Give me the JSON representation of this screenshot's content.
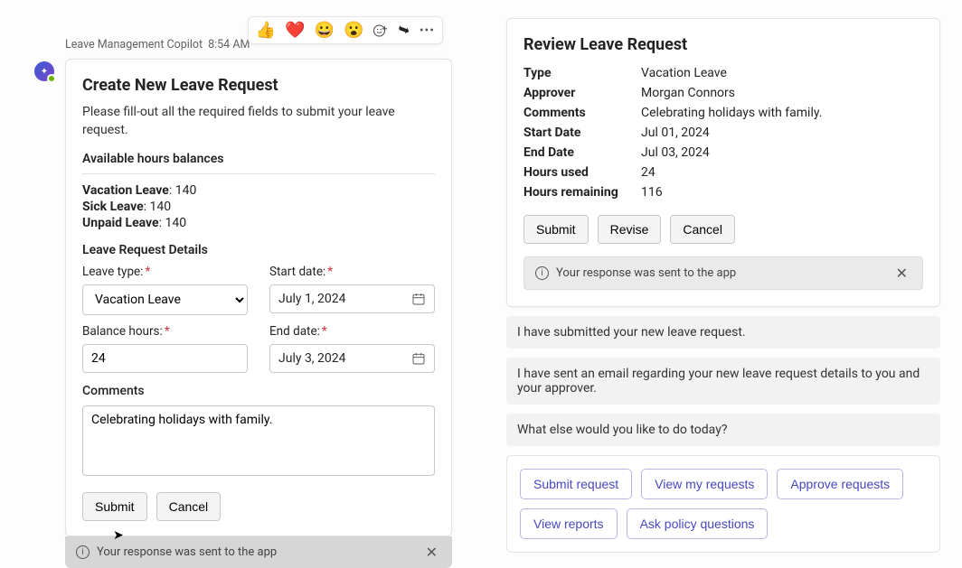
{
  "sender": {
    "name": "Leave Management Copilot",
    "time": "8:54 AM"
  },
  "card1": {
    "title": "Create New Leave Request",
    "intro": "Please fill-out all the required fields to submit your leave request.",
    "balances_heading": "Available hours balances",
    "balances": {
      "vacation_label": "Vacation Leave",
      "vacation_val": "140",
      "sick_label": "Sick Leave",
      "sick_val": "140",
      "unpaid_label": "Unpaid Leave",
      "unpaid_val": "140"
    },
    "details_heading": "Leave Request Details",
    "fields": {
      "leave_type_label": "Leave type:",
      "leave_type_value": "Vacation Leave",
      "start_date_label": "Start date:",
      "start_date_value": "July 1, 2024",
      "balance_hours_label": "Balance hours:",
      "balance_hours_value": "24",
      "end_date_label": "End date:",
      "end_date_value": "July 3, 2024",
      "comments_label": "Comments",
      "comments_value": "Celebrating holidays with family."
    },
    "buttons": {
      "submit": "Submit",
      "cancel": "Cancel"
    },
    "response_sent": "Your response was sent to the app"
  },
  "card2": {
    "title": "Review Leave Request",
    "rows": {
      "type_k": "Type",
      "type_v": "Vacation Leave",
      "approver_k": "Approver",
      "approver_v": "Morgan Connors",
      "comments_k": "Comments",
      "comments_v": "Celebrating holidays with family.",
      "start_k": "Start Date",
      "start_v": "Jul 01, 2024",
      "end_k": "End Date",
      "end_v": "Jul 03, 2024",
      "used_k": "Hours used",
      "used_v": "24",
      "remain_k": "Hours remaining",
      "remain_v": "116"
    },
    "buttons": {
      "submit": "Submit",
      "revise": "Revise",
      "cancel": "Cancel"
    },
    "response_sent": "Your response was sent to the app"
  },
  "bubbles": {
    "b1": "I have submitted your new leave request.",
    "b2": "I have sent an email regarding your new leave request details to you and your approver.",
    "b3": "What else would you like to do today?"
  },
  "chips": {
    "c1": "Submit request",
    "c2": "View my requests",
    "c3": "Approve requests",
    "c4": "View reports",
    "c5": "Ask policy questions"
  }
}
